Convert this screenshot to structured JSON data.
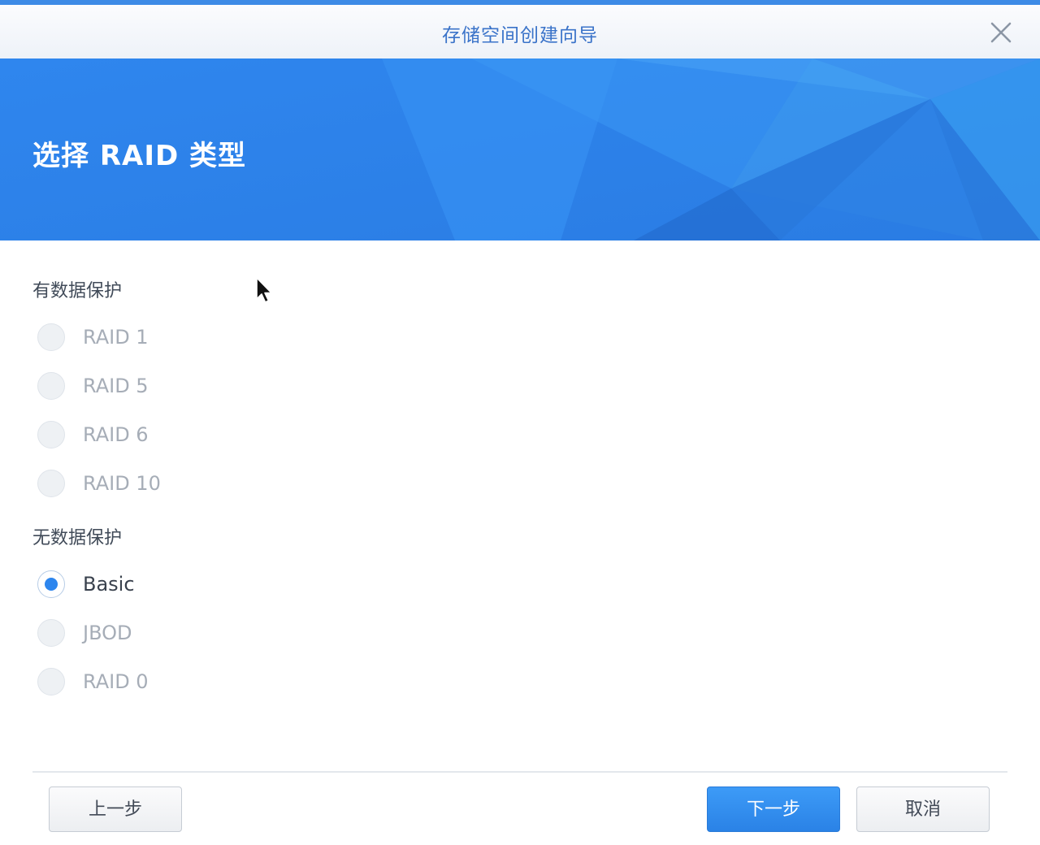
{
  "window": {
    "title": "存储空间创建向导",
    "close_icon": "close-icon"
  },
  "banner": {
    "title": "选择 RAID 类型"
  },
  "groups": [
    {
      "label": "有数据保护",
      "options": [
        {
          "label": "RAID 1",
          "selected": false
        },
        {
          "label": "RAID 5",
          "selected": false
        },
        {
          "label": "RAID 6",
          "selected": false
        },
        {
          "label": "RAID 10",
          "selected": false
        }
      ]
    },
    {
      "label": "无数据保护",
      "options": [
        {
          "label": "Basic",
          "selected": true
        },
        {
          "label": "JBOD",
          "selected": false
        },
        {
          "label": "RAID 0",
          "selected": false
        }
      ]
    }
  ],
  "footer": {
    "back_label": "上一步",
    "next_label": "下一步",
    "cancel_label": "取消"
  },
  "colors": {
    "accent": "#2d86ee",
    "banner": "#2e86ef",
    "title_text": "#3a73c9"
  }
}
